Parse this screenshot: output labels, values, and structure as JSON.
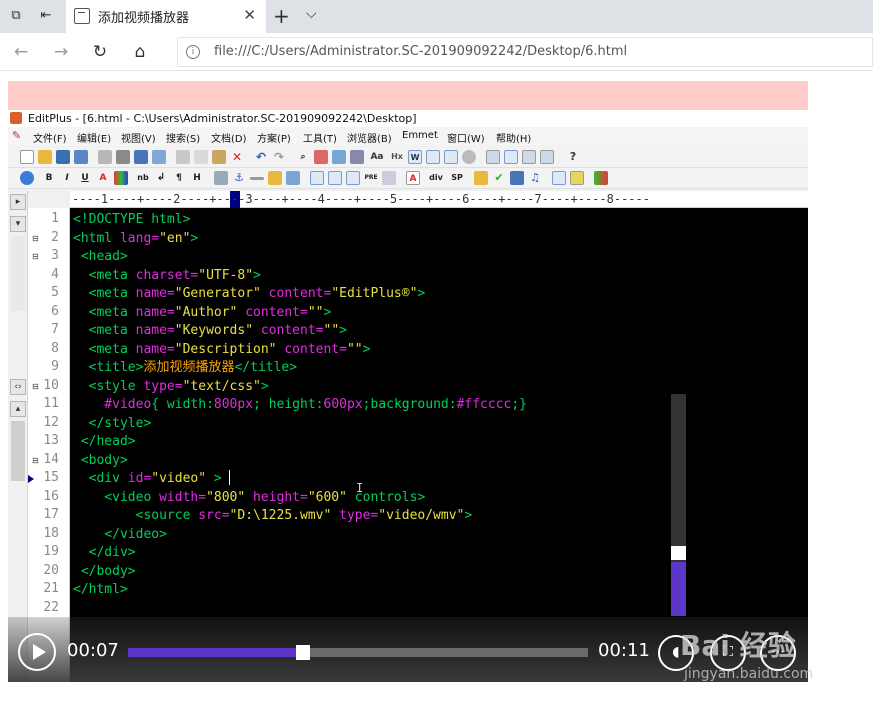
{
  "browser": {
    "tab_title": "添加视频播放器",
    "url": "file:///C:/Users/Administrator.SC-201909092242/Desktop/6.html"
  },
  "editor": {
    "window_title": "EditPlus - [6.html - C:\\Users\\Administrator.SC-201909092242\\Desktop]",
    "menu": [
      "文件(F)",
      "编辑(E)",
      "视图(V)",
      "搜索(S)",
      "文档(D)",
      "方案(P)",
      "工具(T)",
      "浏览器(B)",
      "Emmet",
      "窗口(W)",
      "帮助(H)"
    ],
    "ruler": "----1----+----2----+----3----+----4----+----5----+----6----+----7----+----8-----",
    "toolbar2_labels": [
      "B",
      "I",
      "U",
      "A",
      "nb",
      "¶",
      "H",
      "PRE",
      "div",
      "SP"
    ],
    "line_numbers": [
      "1",
      "2",
      "3",
      "4",
      "5",
      "6",
      "7",
      "8",
      "9",
      "10",
      "11",
      "12",
      "13",
      "14",
      "15",
      "16",
      "17",
      "18",
      "19",
      "20",
      "21",
      "22"
    ],
    "code_lines": [
      [
        {
          "t": "<!DOCTYPE html>",
          "c": "g"
        }
      ],
      [
        {
          "t": "<html ",
          "c": "g"
        },
        {
          "t": "lang=",
          "c": "m"
        },
        {
          "t": "\"en\"",
          "c": "y"
        },
        {
          "t": ">",
          "c": "g"
        }
      ],
      [
        {
          "t": " <head>",
          "c": "g"
        }
      ],
      [
        {
          "t": "  <meta ",
          "c": "g"
        },
        {
          "t": "charset=",
          "c": "m"
        },
        {
          "t": "\"UTF-8\"",
          "c": "y"
        },
        {
          "t": ">",
          "c": "g"
        }
      ],
      [
        {
          "t": "  <meta ",
          "c": "g"
        },
        {
          "t": "name=",
          "c": "m"
        },
        {
          "t": "\"Generator\"",
          "c": "y"
        },
        {
          "t": " content=",
          "c": "m"
        },
        {
          "t": "\"EditPlus®\"",
          "c": "y"
        },
        {
          "t": ">",
          "c": "g"
        }
      ],
      [
        {
          "t": "  <meta ",
          "c": "g"
        },
        {
          "t": "name=",
          "c": "m"
        },
        {
          "t": "\"Author\"",
          "c": "y"
        },
        {
          "t": " content=",
          "c": "m"
        },
        {
          "t": "\"\"",
          "c": "y"
        },
        {
          "t": ">",
          "c": "g"
        }
      ],
      [
        {
          "t": "  <meta ",
          "c": "g"
        },
        {
          "t": "name=",
          "c": "m"
        },
        {
          "t": "\"Keywords\"",
          "c": "y"
        },
        {
          "t": " content=",
          "c": "m"
        },
        {
          "t": "\"\"",
          "c": "y"
        },
        {
          "t": ">",
          "c": "g"
        }
      ],
      [
        {
          "t": "  <meta ",
          "c": "g"
        },
        {
          "t": "name=",
          "c": "m"
        },
        {
          "t": "\"Description\"",
          "c": "y"
        },
        {
          "t": " content=",
          "c": "m"
        },
        {
          "t": "\"\"",
          "c": "y"
        },
        {
          "t": ">",
          "c": "g"
        }
      ],
      [
        {
          "t": "  <title>",
          "c": "g"
        },
        {
          "t": "添加视频播放器",
          "c": "o"
        },
        {
          "t": "</title>",
          "c": "g"
        }
      ],
      [
        {
          "t": "  <style ",
          "c": "g"
        },
        {
          "t": "type=",
          "c": "m"
        },
        {
          "t": "\"text/css\"",
          "c": "y"
        },
        {
          "t": ">",
          "c": "g"
        }
      ],
      [
        {
          "t": "    #video",
          "c": "m"
        },
        {
          "t": "{ width:",
          "c": "g"
        },
        {
          "t": "800px",
          "c": "m"
        },
        {
          "t": "; height:",
          "c": "g"
        },
        {
          "t": "600px",
          "c": "m"
        },
        {
          "t": ";background:",
          "c": "g"
        },
        {
          "t": "#ffcccc",
          "c": "m"
        },
        {
          "t": ";}",
          "c": "g"
        }
      ],
      [
        {
          "t": "  </style>",
          "c": "g"
        }
      ],
      [
        {
          "t": " </head>",
          "c": "g"
        }
      ],
      [
        {
          "t": " <body>",
          "c": "g"
        }
      ],
      [
        {
          "t": "  <div ",
          "c": "g"
        },
        {
          "t": "id=",
          "c": "m"
        },
        {
          "t": "\"video\"",
          "c": "y"
        },
        {
          "t": " >",
          "c": "g"
        }
      ],
      [
        {
          "t": "    <video ",
          "c": "g"
        },
        {
          "t": "width=",
          "c": "m"
        },
        {
          "t": "\"800\"",
          "c": "y"
        },
        {
          "t": " height=",
          "c": "m"
        },
        {
          "t": "\"600\"",
          "c": "y"
        },
        {
          "t": " controls>",
          "c": "g"
        }
      ],
      [
        {
          "t": "        <source ",
          "c": "g"
        },
        {
          "t": "src=",
          "c": "m"
        },
        {
          "t": "\"D:\\1225.wmv\"",
          "c": "y"
        },
        {
          "t": " type=",
          "c": "m"
        },
        {
          "t": "\"video/wmv\"",
          "c": "y"
        },
        {
          "t": ">",
          "c": "g"
        }
      ],
      [
        {
          "t": "    </video>",
          "c": "g"
        }
      ],
      [
        {
          "t": "  </div>",
          "c": "g"
        }
      ],
      [
        {
          "t": " </body>",
          "c": "g"
        }
      ],
      [
        {
          "t": "</html>",
          "c": "g"
        }
      ],
      []
    ]
  },
  "player": {
    "current_time": "00:07",
    "duration": "00:11",
    "progress": 0.38
  },
  "watermark": {
    "line1": "Bai 经验",
    "line2": "jingyan.baidu.com"
  }
}
